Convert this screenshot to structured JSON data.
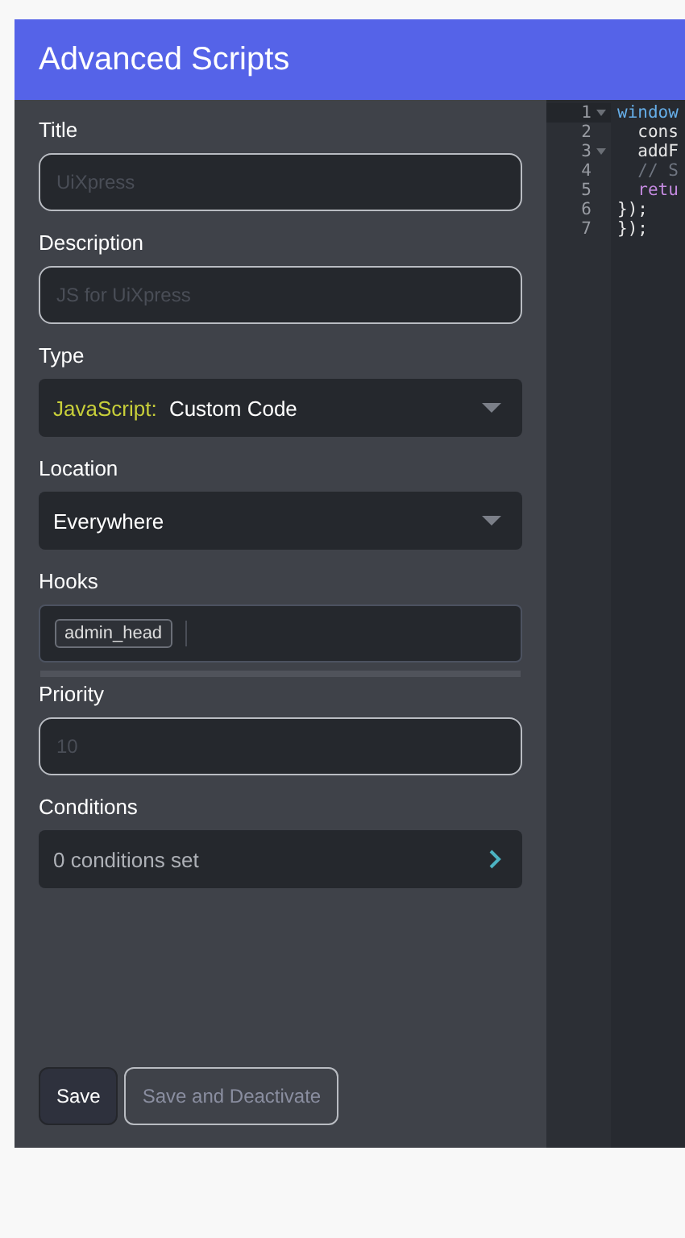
{
  "header": {
    "title": "Advanced Scripts"
  },
  "fields": [
    {
      "kind": "text",
      "label": "Title",
      "placeholder": "UiXpress"
    },
    {
      "kind": "text",
      "label": "Description",
      "placeholder": "JS for UiXpress"
    },
    {
      "kind": "select",
      "label": "Type",
      "prefix": "JavaScript:",
      "value": "Custom Code"
    },
    {
      "kind": "select",
      "label": "Location",
      "value": "Everywhere"
    },
    {
      "kind": "tags",
      "label": "Hooks",
      "tags": [
        "admin_head"
      ]
    },
    {
      "kind": "text",
      "label": "Priority",
      "placeholder": "10"
    },
    {
      "kind": "link",
      "label": "Conditions",
      "value": "0 conditions set"
    }
  ],
  "buttons": [
    {
      "label": "Save",
      "disabled": false
    },
    {
      "label": "Save and Deactivate",
      "disabled": true
    }
  ],
  "editor": {
    "lines": [
      {
        "number": "1",
        "fold": true,
        "code": "window"
      },
      {
        "number": "2",
        "fold": false,
        "code": "  cons"
      },
      {
        "number": "3",
        "fold": true,
        "code": "  addF"
      },
      {
        "number": "4",
        "fold": false,
        "code": "  // S"
      },
      {
        "number": "5",
        "fold": false,
        "code": "  retu"
      },
      {
        "number": "6",
        "fold": false,
        "code": "});"
      },
      {
        "number": "7",
        "fold": false,
        "code": "});"
      }
    ]
  }
}
